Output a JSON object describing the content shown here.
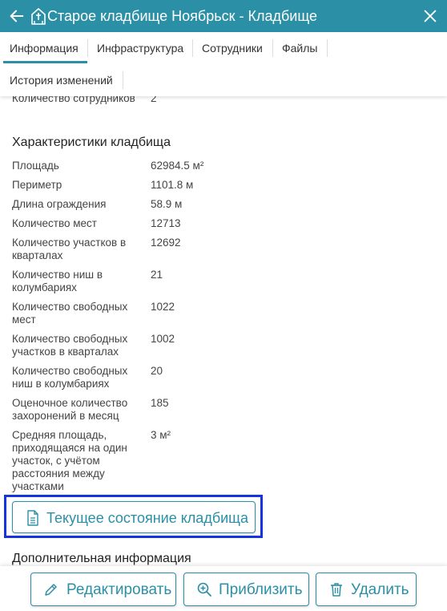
{
  "header": {
    "title": "Старое кладбище Ноябрьск - Кладбище",
    "back_icon": "arrow-left-icon",
    "entity_icon": "cemetery-gate-icon",
    "close_icon": "close-icon",
    "background": "#2b8fa6"
  },
  "tabs": [
    {
      "label": "Информация",
      "active": true
    },
    {
      "label": "Инфраструктура",
      "active": false
    },
    {
      "label": "Сотрудники",
      "active": false
    },
    {
      "label": "Файлы",
      "active": false
    },
    {
      "label": "История изменений",
      "active": false
    }
  ],
  "top_partial": {
    "label": "Количество сотрудников",
    "value": "2"
  },
  "characteristics": {
    "title": "Характеристики кладбища",
    "rows": [
      {
        "label": "Площадь",
        "value": "62984.5 м²"
      },
      {
        "label": "Периметр",
        "value": "1101.8 м"
      },
      {
        "label": "Длина ограждения",
        "value": "58.9 м"
      },
      {
        "label": "Количество мест",
        "value": "12713"
      },
      {
        "label": "Количество участков в кварталах",
        "value": "12692"
      },
      {
        "label": "Количество ниш в колумбариях",
        "value": "21"
      },
      {
        "label": "Количество свободных мест",
        "value": "1022"
      },
      {
        "label": "Количество свободных участков в кварталах",
        "value": "1002"
      },
      {
        "label": "Количество свободных ниш в колумбариях",
        "value": "20"
      },
      {
        "label": "Оценочное количество захоронений в месяц",
        "value": "185"
      },
      {
        "label": "Средняя площадь, приходящаяся на один участок, с учётом расстояния между участками",
        "value": "3 м²"
      }
    ]
  },
  "state_button": {
    "label": "Текущее состояние кладбища",
    "icon": "document-icon"
  },
  "additional": {
    "title": "Дополнительная информация"
  },
  "footer": {
    "edit": {
      "label": "Редактировать",
      "icon": "pencil-icon"
    },
    "zoom": {
      "label": "Приблизить",
      "icon": "zoom-in-icon"
    },
    "delete": {
      "label": "Удалить",
      "icon": "trash-icon"
    }
  },
  "colors": {
    "accent": "#2b8fa6",
    "highlight": "#1533e0"
  }
}
